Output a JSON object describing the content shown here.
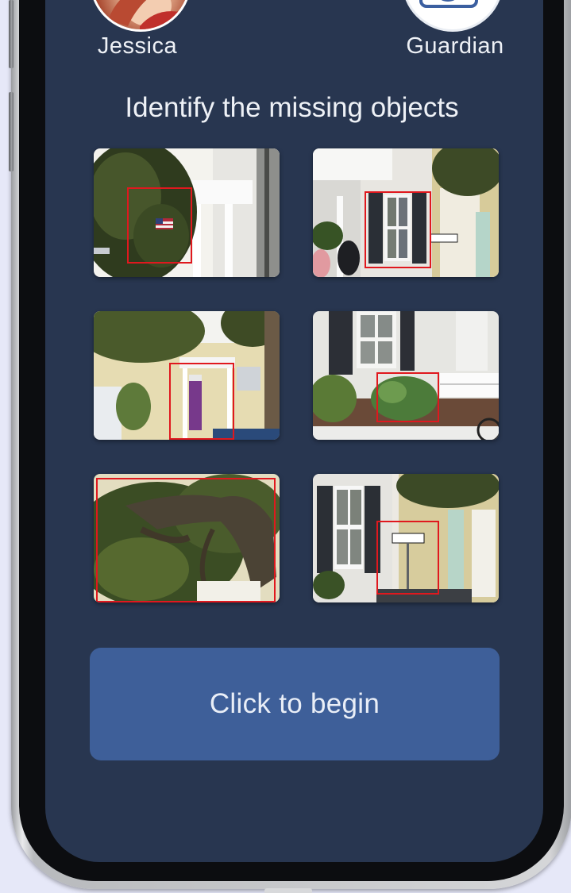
{
  "players": {
    "left": {
      "name": "Jessica",
      "avatar_icon": "user-photo-icon"
    },
    "right": {
      "name": "Guardian",
      "avatar_icon": "camera-icon"
    }
  },
  "game": {
    "title": "Identify the missing objects",
    "tiles": [
      {
        "subject": "magnolia-tree-with-flag",
        "highlight_color": "#e0181e"
      },
      {
        "subject": "window-with-shutters",
        "highlight_color": "#e0181e"
      },
      {
        "subject": "purple-front-door",
        "highlight_color": "#e0181e"
      },
      {
        "subject": "green-shrub",
        "highlight_color": "#e0181e"
      },
      {
        "subject": "live-oak-branches",
        "highlight_color": "#e0181e"
      },
      {
        "subject": "one-way-sign",
        "highlight_color": "#e0181e"
      }
    ],
    "begin_label": "Click to begin"
  },
  "colors": {
    "screen_background": "#283650",
    "button_background": "#3e5f99",
    "highlight": "#e0181e"
  }
}
